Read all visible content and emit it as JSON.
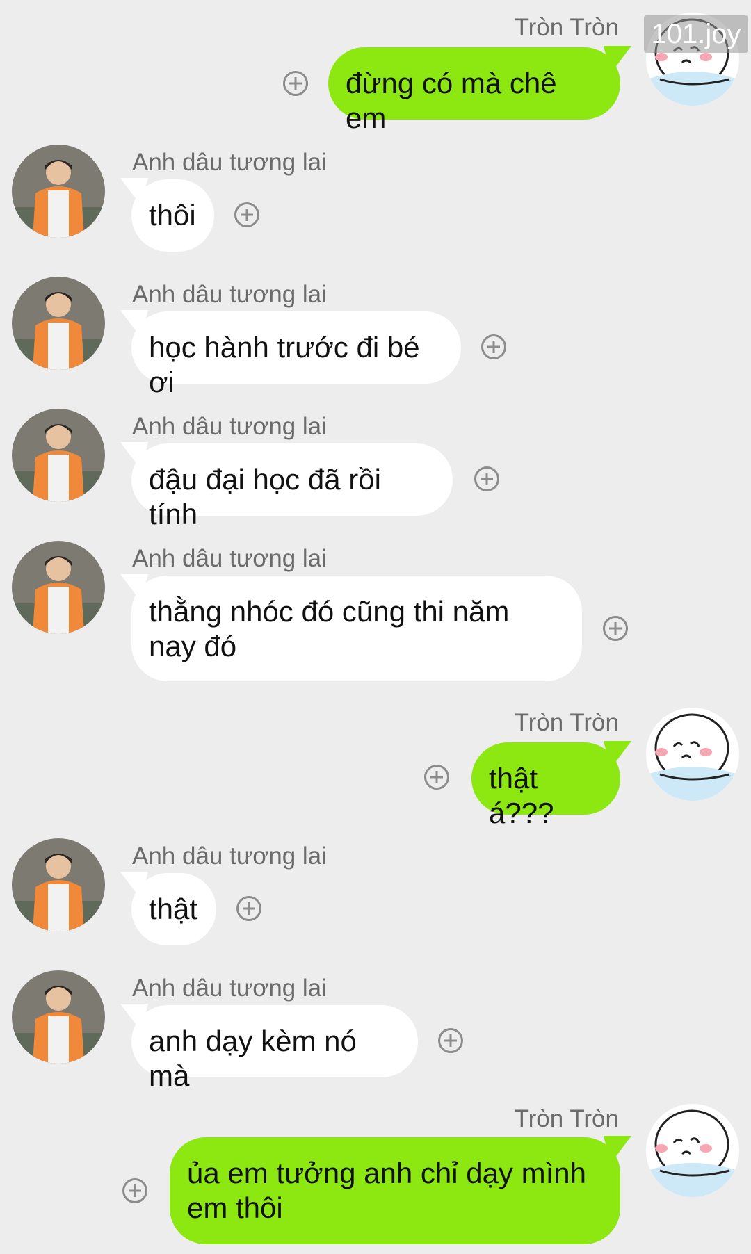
{
  "watermark": "101.joy",
  "messages": [
    {
      "side": "out",
      "sender": "Tròn Tròn",
      "text": "đừng có mà chê em",
      "avatar": "cartoon-crying-face"
    },
    {
      "side": "in",
      "sender": "Anh dâu tương lai",
      "text": "thôi",
      "avatar": "boy-orange-jacket"
    },
    {
      "side": "in",
      "sender": "Anh dâu tương lai",
      "text": "học hành trước đi bé ơi",
      "avatar": "boy-orange-jacket"
    },
    {
      "side": "in",
      "sender": "Anh dâu tương lai",
      "text": "đậu đại học đã rồi tính",
      "avatar": "boy-orange-jacket"
    },
    {
      "side": "in",
      "sender": "Anh dâu tương lai",
      "text": "thằng nhóc đó cũng thi năm nay đó",
      "avatar": "boy-orange-jacket"
    },
    {
      "side": "out",
      "sender": "Tròn Tròn",
      "text": "thật á???",
      "avatar": "cartoon-crying-face"
    },
    {
      "side": "in",
      "sender": "Anh dâu tương lai",
      "text": "thật",
      "avatar": "boy-orange-jacket"
    },
    {
      "side": "in",
      "sender": "Anh dâu tương lai",
      "text": "anh dạy kèm nó mà",
      "avatar": "boy-orange-jacket"
    },
    {
      "side": "out",
      "sender": "Tròn Tròn",
      "text": "ủa em tưởng anh chỉ dạy mình em thôi",
      "avatar": "cartoon-crying-face"
    }
  ],
  "colors": {
    "background": "#ededed",
    "outgoing_bubble": "#8de710",
    "incoming_bubble": "#ffffff"
  }
}
